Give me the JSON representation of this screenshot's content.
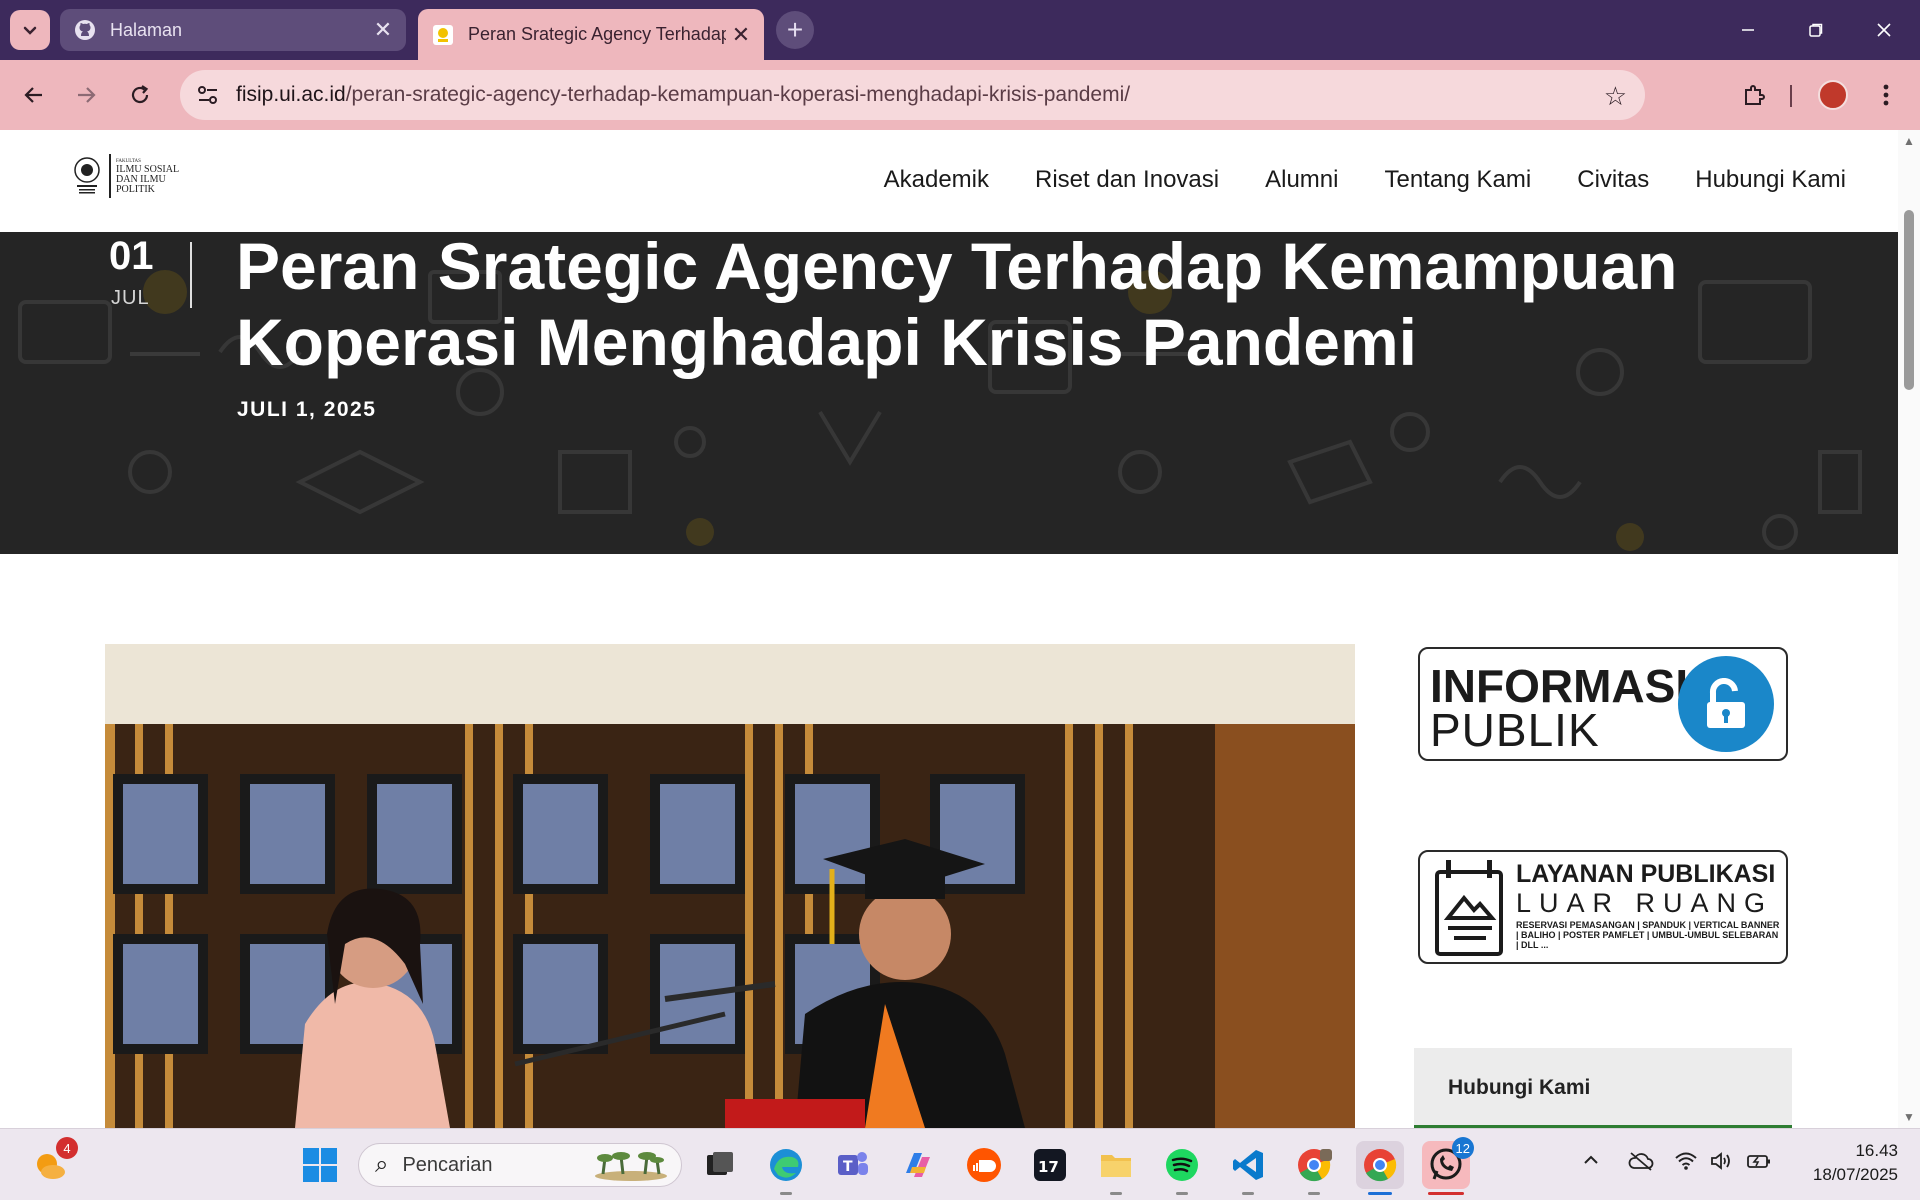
{
  "browser": {
    "tabs": [
      {
        "title": "Halaman",
        "icon": "github-icon",
        "active": false
      },
      {
        "title": "Peran Srategic Agency Terhadap",
        "icon": "ui-favicon-icon",
        "active": true
      }
    ],
    "address": {
      "domain": "fisip.ui.ac.id",
      "path": "/peran-srategic-agency-terhadap-kemampuan-koperasi-menghadapi-krisis-pandemi/"
    },
    "accent": "#eeb7bd",
    "frame_color": "#3d2a5c"
  },
  "site": {
    "logo_lines": [
      "FAKULTAS",
      "ILMU SOSIAL",
      "DAN ILMU",
      "POLITIK"
    ],
    "nav": [
      "Akademik",
      "Riset dan Inovasi",
      "Alumni",
      "Tentang Kami",
      "Civitas",
      "Hubungi Kami"
    ]
  },
  "hero": {
    "day": "01",
    "month": "JUL",
    "title": "Peran Srategic Agency Terhadap Kemampuan Koperasi Menghadapi Krisis Pandemi",
    "date": "JULI 1, 2025"
  },
  "sidebar": {
    "info_publik": {
      "line1": "INFORMASI",
      "line2": "PUBLIK",
      "color": "#1a87c9"
    },
    "publikasi": {
      "line1": "LAYANAN PUBLIKASI",
      "line2": "LUAR RUANG",
      "line3": "RESERVASI PEMASANGAN | SPANDUK | VERTICAL BANNER | BALIHO | POSTER PAMFLET | UMBUL-UMBUL SELEBARAN | DLL ..."
    },
    "contact_title": "Hubungi Kami"
  },
  "taskbar": {
    "search_placeholder": "Pencarian",
    "weather_badge": "4",
    "whatsapp_badge": "12",
    "time": "16.43",
    "date": "18/07/2025"
  }
}
